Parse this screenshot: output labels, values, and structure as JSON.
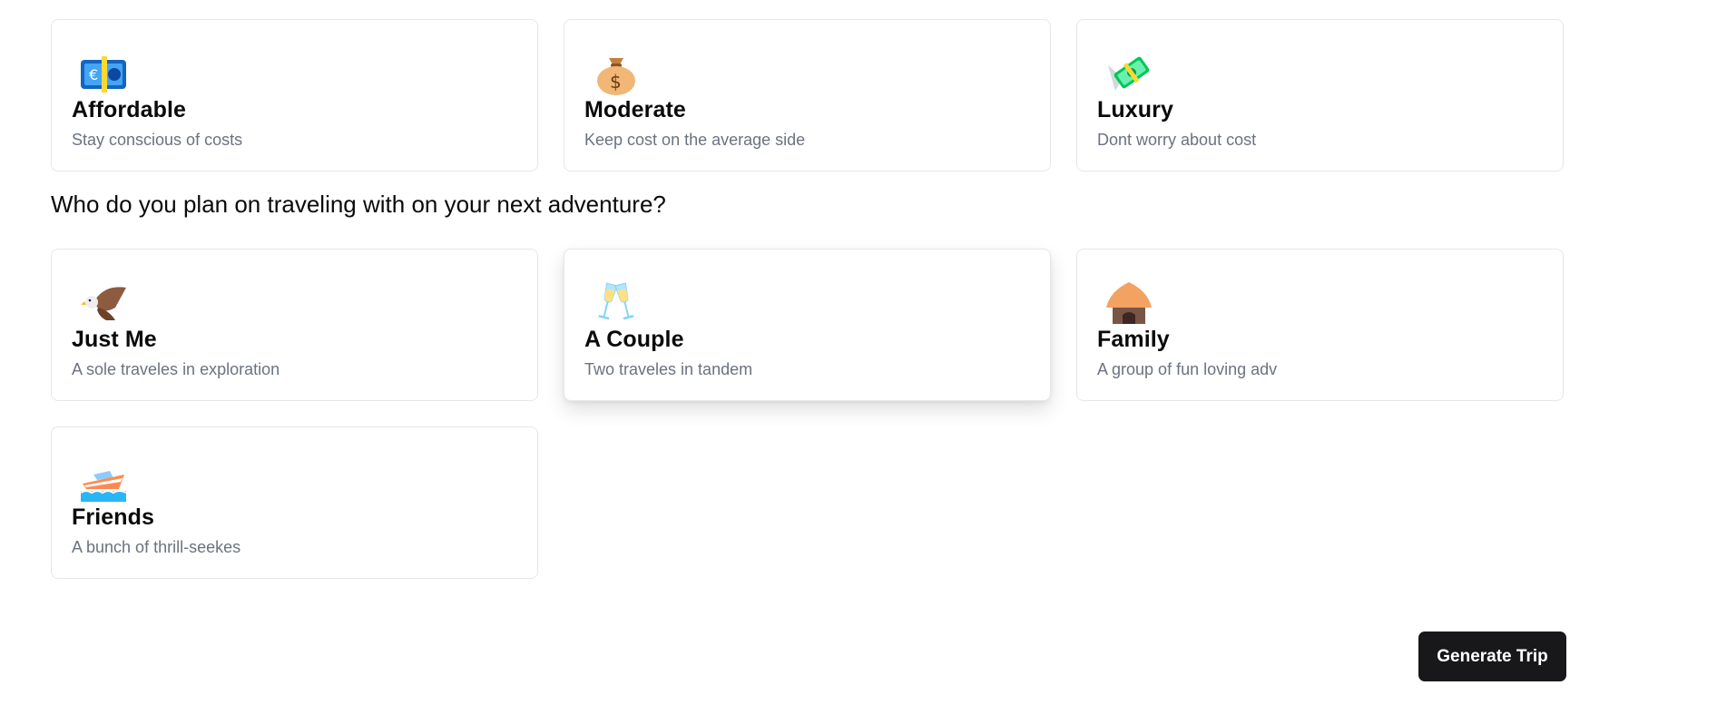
{
  "budget": {
    "options": [
      {
        "icon": "euro-banknote-icon",
        "title": "Affordable",
        "desc": "Stay conscious of costs"
      },
      {
        "icon": "money-bag-icon",
        "title": "Moderate",
        "desc": "Keep cost on the average side"
      },
      {
        "icon": "money-with-wings-icon",
        "title": "Luxury",
        "desc": "Dont worry about cost"
      }
    ]
  },
  "travelers": {
    "heading": "Who do you plan on traveling with on your next adventure?",
    "selected": "A Couple",
    "options": [
      {
        "icon": "eagle-icon",
        "title": "Just Me",
        "desc": "A sole traveles in exploration"
      },
      {
        "icon": "clinking-glasses-icon",
        "title": "A Couple",
        "desc": "Two traveles in tandem"
      },
      {
        "icon": "hut-icon",
        "title": "Family",
        "desc": "A group of fun loving adv"
      },
      {
        "icon": "speedboat-icon",
        "title": "Friends",
        "desc": "A bunch of thrill-seekes"
      }
    ]
  },
  "actions": {
    "generate_label": "Generate Trip"
  },
  "colors": {
    "button_bg": "#18181b",
    "card_border": "#e5e7eb",
    "desc_text": "#6b7280"
  }
}
